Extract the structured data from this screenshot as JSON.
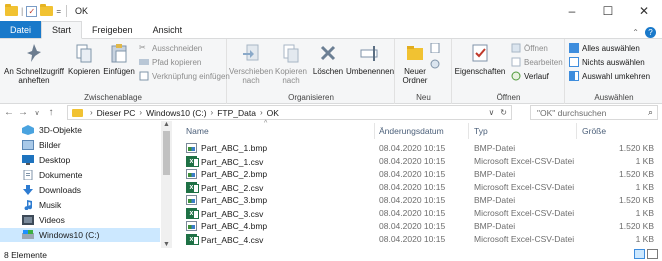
{
  "window": {
    "title": "OK",
    "minimize_glyph": "–",
    "maximize_glyph": "☐",
    "close_glyph": "✕"
  },
  "quick_access": {
    "separator": "|",
    "dropdown": "="
  },
  "tabs": [
    {
      "label": "Datei"
    },
    {
      "label": "Start"
    },
    {
      "label": "Freigeben"
    },
    {
      "label": "Ansicht"
    }
  ],
  "ribbon": {
    "clipboard": {
      "pin_label": "An Schnellzugriff anheften",
      "copy_label": "Kopieren",
      "paste_label": "Einfügen",
      "cut_label": "Ausschneiden",
      "copy_path_label": "Pfad kopieren",
      "paste_shortcut_label": "Verknüpfung einfügen",
      "group_label": "Zwischenablage"
    },
    "organize": {
      "move_label": "Verschieben nach",
      "copy_to_label": "Kopieren nach",
      "delete_label": "Löschen",
      "rename_label": "Umbenennen",
      "group_label": "Organisieren"
    },
    "new": {
      "new_folder_label": "Neuer Ordner",
      "group_label": "Neu"
    },
    "open": {
      "properties_label": "Eigenschaften",
      "open_label": "Öffnen",
      "edit_label": "Bearbeiten",
      "history_label": "Verlauf",
      "group_label": "Öffnen"
    },
    "select": {
      "select_all_label": "Alles auswählen",
      "select_none_label": "Nichts auswählen",
      "invert_label": "Auswahl umkehren",
      "group_label": "Auswählen"
    }
  },
  "address": {
    "crumbs": [
      "Dieser PC",
      "Windows10 (C:)",
      "FTP_Data",
      "OK"
    ],
    "search_placeholder": "\"OK\" durchsuchen"
  },
  "nav_pane": {
    "items": [
      {
        "label": "3D-Objekte",
        "icon": "3d-objects-icon"
      },
      {
        "label": "Bilder",
        "icon": "pictures-icon"
      },
      {
        "label": "Desktop",
        "icon": "desktop-icon"
      },
      {
        "label": "Dokumente",
        "icon": "documents-icon"
      },
      {
        "label": "Downloads",
        "icon": "downloads-icon"
      },
      {
        "label": "Musik",
        "icon": "music-icon"
      },
      {
        "label": "Videos",
        "icon": "videos-icon"
      },
      {
        "label": "Windows10 (C:)",
        "icon": "drive-icon"
      }
    ]
  },
  "file_list": {
    "columns": {
      "name": "Name",
      "date": "Änderungsdatum",
      "type": "Typ",
      "size": "Größe"
    },
    "rows": [
      {
        "name": "Part_ABC_1.bmp",
        "date": "08.04.2020 10:15",
        "type": "BMP-Datei",
        "size": "1.520 KB"
      },
      {
        "name": "Part_ABC_1.csv",
        "date": "08.04.2020 10:15",
        "type": "Microsoft Excel-CSV-Datei",
        "size": "1 KB"
      },
      {
        "name": "Part_ABC_2.bmp",
        "date": "08.04.2020 10:15",
        "type": "BMP-Datei",
        "size": "1.520 KB"
      },
      {
        "name": "Part_ABC_2.csv",
        "date": "08.04.2020 10:15",
        "type": "Microsoft Excel-CSV-Datei",
        "size": "1 KB"
      },
      {
        "name": "Part_ABC_3.bmp",
        "date": "08.04.2020 10:15",
        "type": "BMP-Datei",
        "size": "1.520 KB"
      },
      {
        "name": "Part_ABC_3.csv",
        "date": "08.04.2020 10:15",
        "type": "Microsoft Excel-CSV-Datei",
        "size": "1 KB"
      },
      {
        "name": "Part_ABC_4.bmp",
        "date": "08.04.2020 10:15",
        "type": "BMP-Datei",
        "size": "1.520 KB"
      },
      {
        "name": "Part_ABC_4.csv",
        "date": "08.04.2020 10:15",
        "type": "Microsoft Excel-CSV-Datei",
        "size": "1 KB"
      }
    ]
  },
  "status": {
    "count_text": "8 Elemente"
  }
}
